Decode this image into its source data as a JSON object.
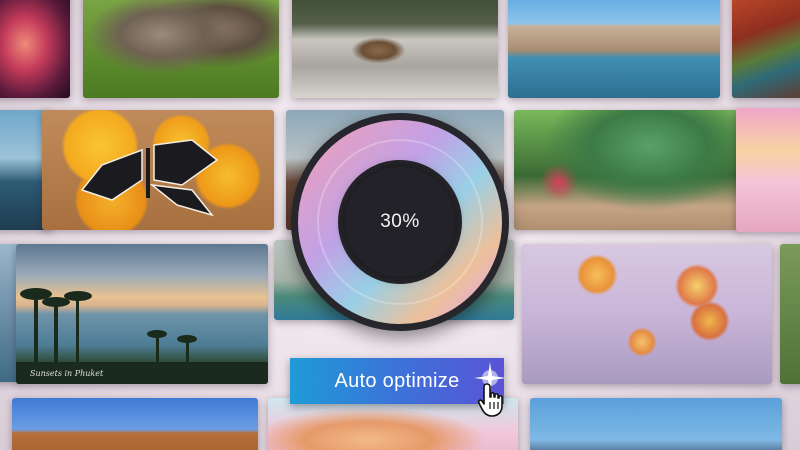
{
  "progress": {
    "label": "30%",
    "fraction": 0.3
  },
  "auto_optimize": {
    "label": "Auto optimize"
  },
  "photos": {
    "sunset_credit": "Sunsets in Phuket",
    "lagoon_credit": "",
    "flowers_credit": "",
    "venice_credit": ""
  },
  "colors": {
    "button_start": "#1e9bd7",
    "button_end": "#5a54d6",
    "ring_dark": "#26262c"
  },
  "icons": {
    "cursor": "hand-pointer-icon",
    "sparkle": "sparkle-icon"
  }
}
